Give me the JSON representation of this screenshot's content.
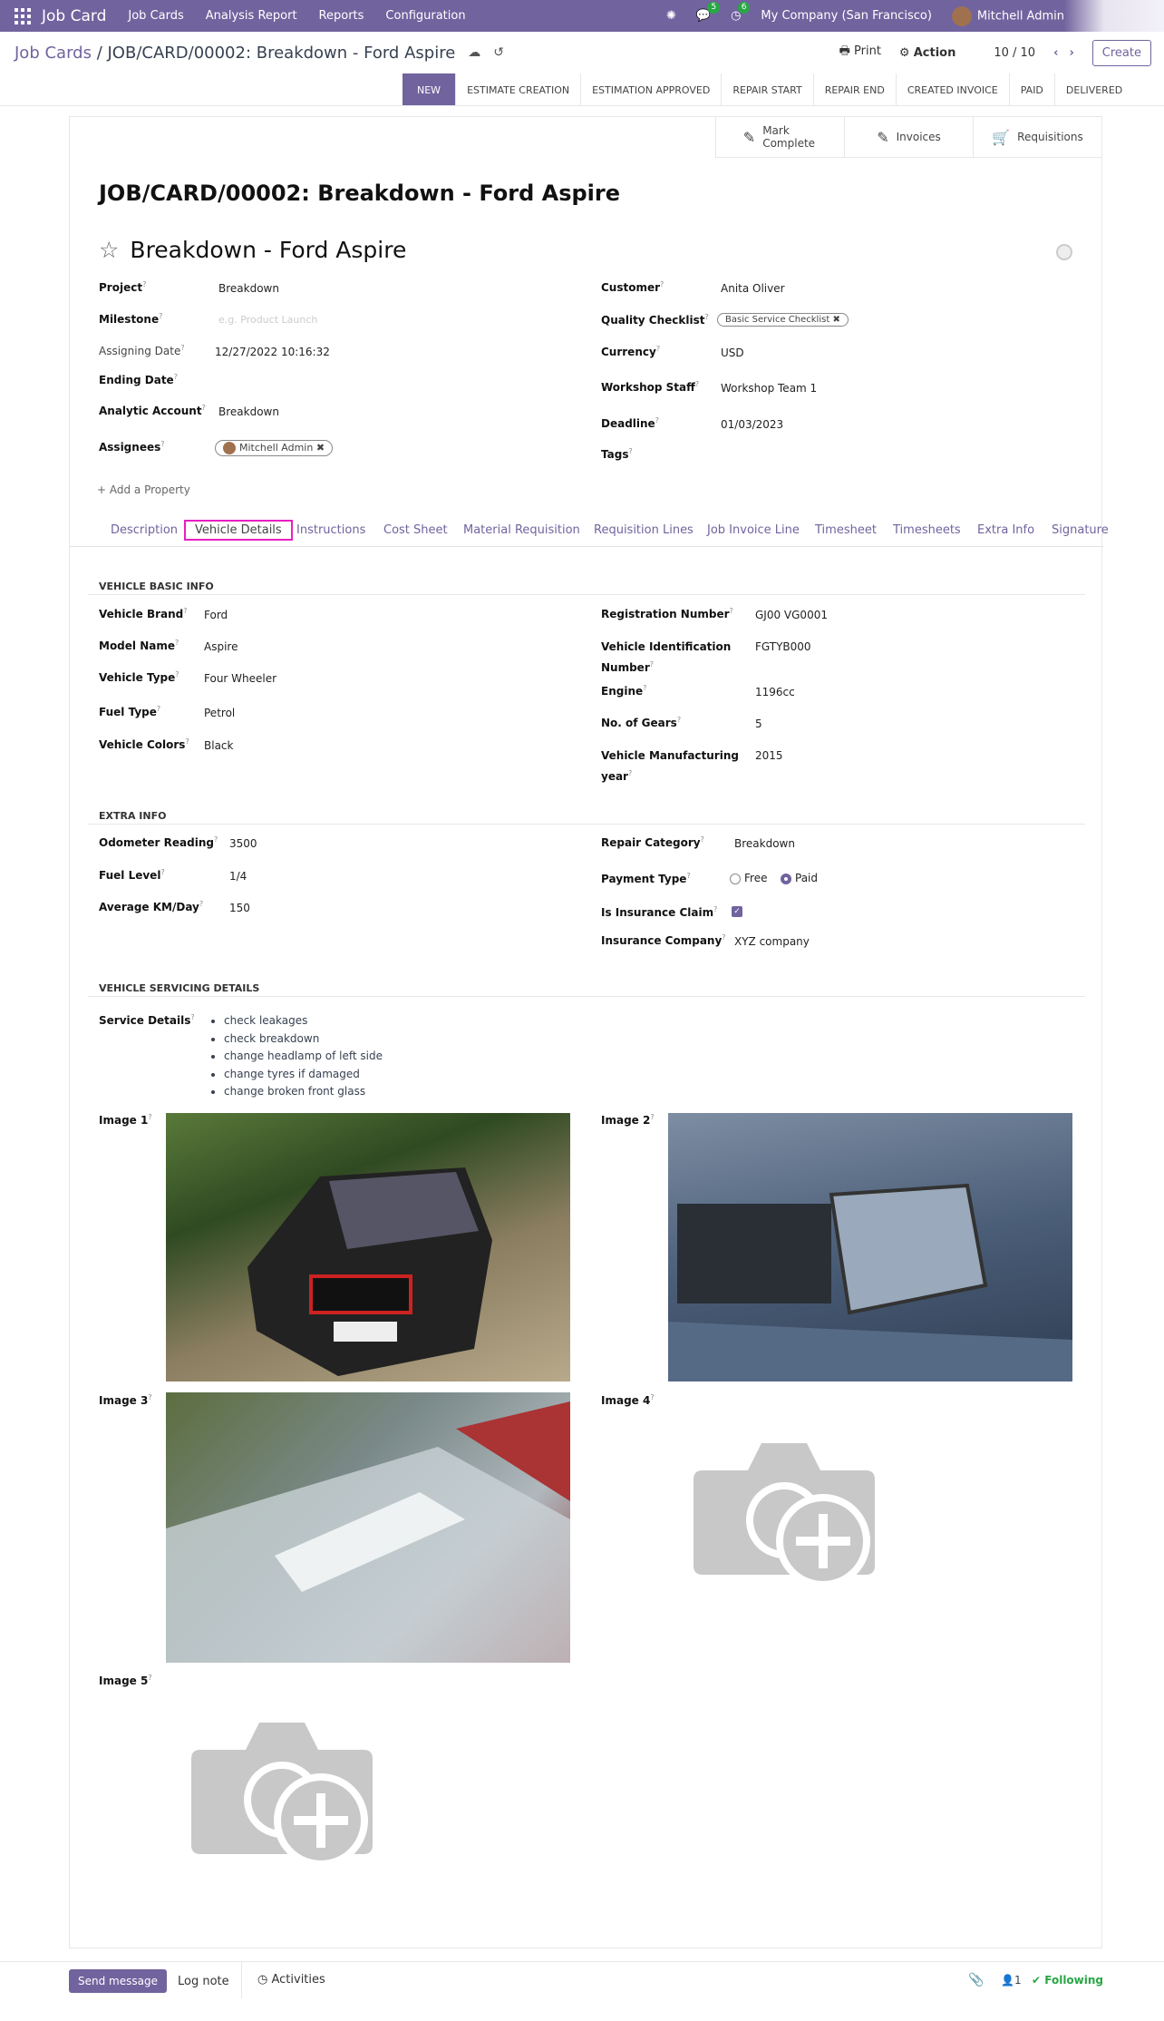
{
  "topbar": {
    "app": "Job Card",
    "menus": [
      "Job Cards",
      "Analysis Report",
      "Reports",
      "Configuration"
    ],
    "chat_count": "5",
    "activity_count": "6",
    "company": "My Company (San Francisco)",
    "user": "Mitchell Admin"
  },
  "control": {
    "breadcrumb_root": "Job Cards",
    "breadcrumb_current": "/ JOB/CARD/00002: Breakdown - Ford Aspire",
    "print": "Print",
    "action": "Action",
    "pager": "10 / 10",
    "create": "Create"
  },
  "statusbar": [
    "NEW",
    "ESTIMATE CREATION",
    "ESTIMATION APPROVED",
    "REPAIR START",
    "REPAIR END",
    "CREATED INVOICE",
    "PAID",
    "DELIVERED"
  ],
  "smart_buttons": {
    "mark_complete": "Mark Complete",
    "invoices": "Invoices",
    "requisitions": "Requisitions"
  },
  "title": "JOB/CARD/00002: Breakdown - Ford Aspire",
  "task_name": "Breakdown - Ford Aspire",
  "left_fields": {
    "project_label": "Project",
    "project": "Breakdown",
    "milestone_label": "Milestone",
    "milestone_ph": "e.g. Product Launch",
    "assign_label": "Assigning Date",
    "assign": "12/27/2022 10:16:32",
    "ending_label": "Ending Date",
    "analytic_label": "Analytic Account",
    "analytic": "Breakdown",
    "assignees_label": "Assignees",
    "assignee": "Mitchell Admin"
  },
  "right_fields": {
    "customer_label": "Customer",
    "customer": "Anita Oliver",
    "quality_label": "Quality Checklist",
    "quality": "Basic Service Checklist",
    "currency_label": "Currency",
    "currency": "USD",
    "staff_label": "Workshop Staff",
    "staff": "Workshop Team 1",
    "deadline_label": "Deadline",
    "deadline": "01/03/2023",
    "tags_label": "Tags"
  },
  "add_property": "Add a Property",
  "tabs": [
    "Description",
    "Vehicle Details",
    "Instructions",
    "Cost Sheet",
    "Material Requisition",
    "Requisition Lines",
    "Job Invoice Line",
    "Timesheet",
    "Timesheets",
    "Extra Info",
    "Signature"
  ],
  "vehicle": {
    "section": "VEHICLE BASIC INFO",
    "brand_label": "Vehicle Brand",
    "brand": "Ford",
    "model_label": "Model Name",
    "model": "Aspire",
    "type_label": "Vehicle Type",
    "type": "Four Wheeler",
    "fuel_label": "Fuel Type",
    "fuel": "Petrol",
    "colors_label": "Vehicle Colors",
    "colors": "Black",
    "reg_label": "Registration Number",
    "reg": "GJ00 VG0001",
    "vin_label1": "Vehicle Identification",
    "vin_label2": "Number",
    "vin": "FGTYB000",
    "engine_label": "Engine",
    "engine": "1196cc",
    "gears_label": "No. of Gears",
    "gears": "5",
    "year_label1": "Vehicle Manufacturing",
    "year_label2": "year",
    "year": "2015"
  },
  "extra": {
    "section": "EXTRA INFO",
    "odo_label": "Odometer Reading",
    "odo": "3500",
    "fuel_label": "Fuel Level",
    "fuel": "1/4",
    "avg_label": "Average KM/Day",
    "avg": "150",
    "repair_label": "Repair Category",
    "repair": "Breakdown",
    "payment_label": "Payment Type",
    "free": "Free",
    "paid": "Paid",
    "insurance_label": "Is Insurance Claim",
    "company_label": "Insurance Company",
    "company": "XYZ company"
  },
  "servicing": {
    "section": "VEHICLE SERVICING DETAILS",
    "label": "Service Details",
    "items": [
      "check leakages",
      "check breakdown",
      "change headlamp of left side",
      "change tyres if damaged",
      "change broken front glass"
    ]
  },
  "images": {
    "img1": "Image 1",
    "img2": "Image 2",
    "img3": "Image 3",
    "img4": "Image 4",
    "img5": "Image 5"
  },
  "chatter": {
    "send": "Send message",
    "log": "Log note",
    "activities": "Activities",
    "followers": "1",
    "following": "Following"
  }
}
